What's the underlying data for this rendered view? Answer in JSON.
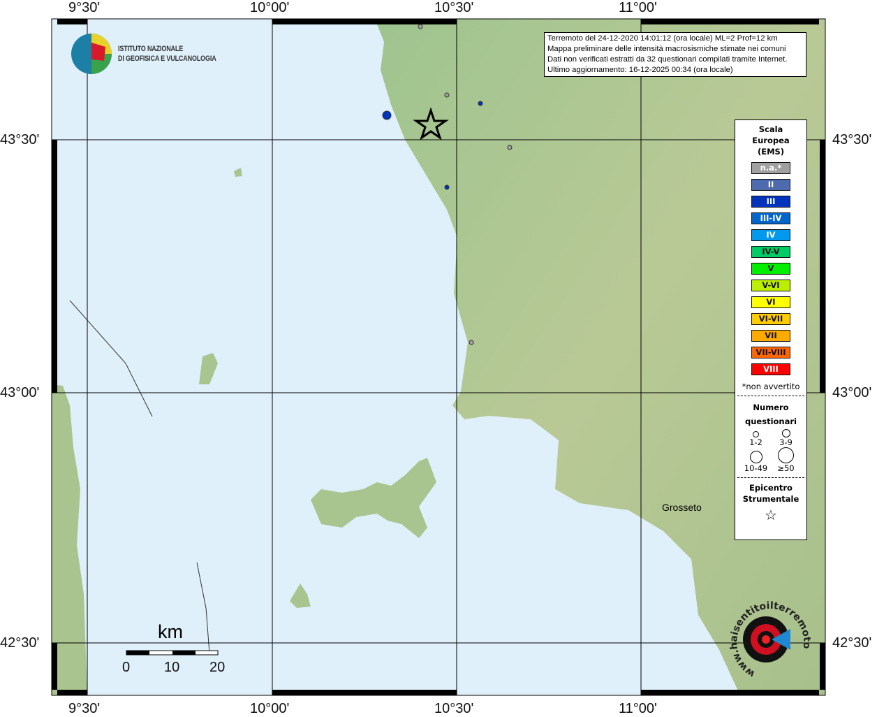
{
  "map": {
    "lon_labels": [
      "9°30'",
      "10°00'",
      "10°30'",
      "11°00'"
    ],
    "lat_labels": [
      "43°30'",
      "43°00'",
      "42°30'"
    ],
    "place": "Grosseto",
    "scale": {
      "unit": "km",
      "ticks": [
        "0",
        "10",
        "20"
      ]
    }
  },
  "logo": {
    "line1": "ISTITUTO NAZIONALE",
    "line2": "DI GEOFISICA E VULCANOLOGIA"
  },
  "info": {
    "line1": "Terremoto del 24-12-2020 14:01:12 (ora locale) ML=2 Prof=12 km",
    "line2": "Mappa preliminare delle intensità macrosismiche stimate nei comuni",
    "line3": "Dati non verificati estratti da 32 questionari compilati tramite Internet.",
    "line4": "Ultimo aggiornamento: 16-12-2025 00:34 (ora locale)"
  },
  "legend": {
    "title1": "Scala",
    "title2": "Europea",
    "title3": "(EMS)",
    "classes": [
      {
        "label": "n.a.*",
        "color": "#a0a0a0"
      },
      {
        "label": "II",
        "color": "#4e6bb0"
      },
      {
        "label": "III",
        "color": "#0033bb"
      },
      {
        "label": "III-IV",
        "color": "#0066cc"
      },
      {
        "label": "IV",
        "color": "#0099ee"
      },
      {
        "label": "IV-V",
        "color": "#00cc66"
      },
      {
        "label": "V",
        "color": "#00ee00"
      },
      {
        "label": "V-VI",
        "color": "#bbee00"
      },
      {
        "label": "VI",
        "color": "#ffff00"
      },
      {
        "label": "VI-VII",
        "color": "#ffcc00"
      },
      {
        "label": "VII",
        "color": "#ffaa00"
      },
      {
        "label": "VII-VIII",
        "color": "#ff6600"
      },
      {
        "label": "VIII",
        "color": "#ff0000"
      }
    ],
    "note": "*non avvertito",
    "count_title1": "Numero",
    "count_title2": "questionari",
    "counts": [
      "1-2",
      "3-9",
      "10-49",
      "≥50"
    ],
    "epi1": "Epicentro",
    "epi2": "Strumentale"
  },
  "watermark": "www.haisentitoilterremoto.it",
  "points": [
    {
      "intensity": "III",
      "n": "3-9"
    },
    {
      "intensity": "n.a.",
      "n": "1-2"
    },
    {
      "intensity": "III",
      "n": "1-2"
    },
    {
      "intensity": "n.a.",
      "n": "1-2"
    },
    {
      "intensity": "III",
      "n": "1-2"
    },
    {
      "intensity": "n.a.",
      "n": "1-2"
    },
    {
      "intensity": "n.a.",
      "n": "1-2"
    }
  ]
}
